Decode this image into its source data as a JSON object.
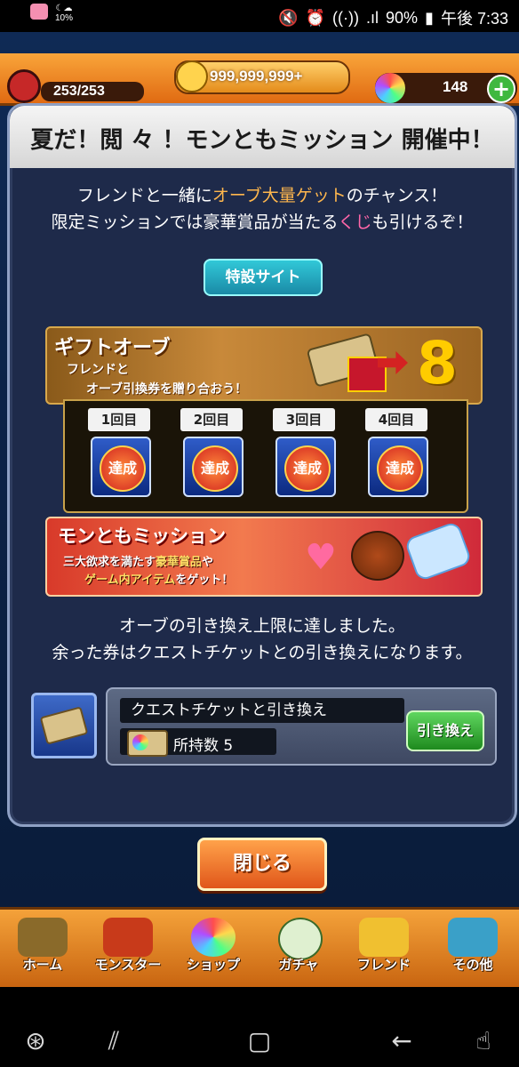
{
  "status_bar": {
    "weather": "10%",
    "battery": "90%",
    "time": "午後 7:33"
  },
  "top_bar": {
    "stamina": "253/253",
    "gold": "999,999,999+",
    "orbs": "148",
    "plus": "+"
  },
  "modal": {
    "title": "夏だ！閲 々 ！モンともミッション 開催中！",
    "desc_line1_a": "フレンドと一緒に",
    "desc_line1_b": "オーブ大量ゲット",
    "desc_line1_c": "のチャンス！",
    "desc_line2_a": "限定ミッションでは豪華賞品が当たる",
    "desc_line2_b": "くじ",
    "desc_line2_c": "も引けるぞ！",
    "special_site_button": "特設サイト",
    "gift_banner": {
      "title": "ギフトオーブ",
      "sub1": "フレンドと",
      "sub2": "オーブ引換券を贈り合おう！",
      "big_number": "8"
    },
    "attempts": [
      {
        "label": "1回目",
        "status": "達成"
      },
      {
        "label": "2回目",
        "status": "達成"
      },
      {
        "label": "3回目",
        "status": "達成"
      },
      {
        "label": "4回目",
        "status": "達成"
      }
    ],
    "mission_banner": {
      "title": "モンともミッション",
      "sub1_a": "三大欲求を満たす",
      "sub1_b": "豪華賞品",
      "sub1_c": "や",
      "sub2_a": "ゲーム内アイテム",
      "sub2_b": "をゲット！"
    },
    "notice_line1": "オーブの引き換え上限に達しました。",
    "notice_line2": "余った券はクエストチケットとの引き換えになります。",
    "exchange": {
      "label": "クエストチケットと引き換え",
      "count_text": "所持数 5",
      "button": "引き換え"
    },
    "close_button": "閉じる"
  },
  "bottom_nav": [
    {
      "label": "ホーム",
      "icon": "home-icon"
    },
    {
      "label": "モンスター",
      "icon": "monster-icon"
    },
    {
      "label": "ショップ",
      "icon": "shop-orb-icon"
    },
    {
      "label": "ガチャ",
      "icon": "gacha-egg-icon"
    },
    {
      "label": "フレンド",
      "icon": "friend-icon"
    },
    {
      "label": "その他",
      "icon": "other-icon"
    }
  ],
  "colors": {
    "accent_orange": "#e06a12",
    "modal_bg": "#1e2a4a",
    "highlight_orange": "#ffb74d",
    "highlight_pink": "#ff66a8",
    "exchange_green": "#1e8a1e"
  }
}
